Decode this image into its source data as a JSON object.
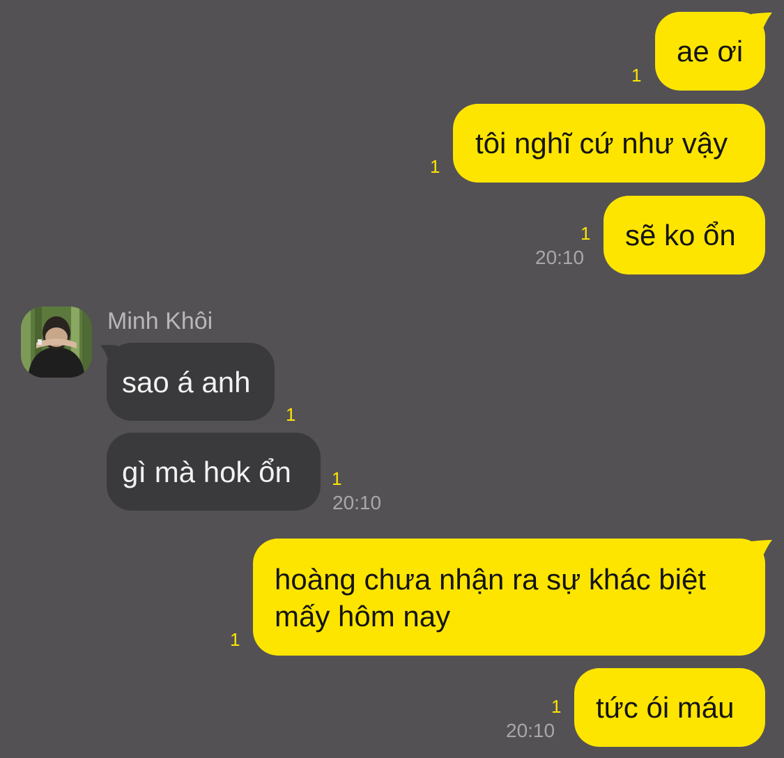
{
  "colors": {
    "background": "#535154",
    "outgoing_bubble": "#fee500",
    "incoming_bubble": "#3a393b",
    "unread_count": "#fee500",
    "timestamp": "#a9a7aa"
  },
  "contact": {
    "name": "Minh Khôi",
    "avatar_icon": "profile-photo"
  },
  "messages": [
    {
      "direction": "outgoing",
      "text": "ae ơi",
      "unread": "1",
      "time": ""
    },
    {
      "direction": "outgoing",
      "text": "tôi nghĩ cứ như vậy",
      "unread": "1",
      "time": ""
    },
    {
      "direction": "outgoing",
      "text": "sẽ ko ổn",
      "unread": "1",
      "time": "20:10"
    },
    {
      "direction": "incoming",
      "text": "sao á anh",
      "unread": "1",
      "time": ""
    },
    {
      "direction": "incoming",
      "text": "gì mà hok ổn",
      "unread": "1",
      "time": "20:10"
    },
    {
      "direction": "outgoing",
      "text": "hoàng chưa nhận ra sự khác biệt mấy hôm nay",
      "unread": "1",
      "time": ""
    },
    {
      "direction": "outgoing",
      "text": "tức ói máu",
      "unread": "1",
      "time": "20:10"
    }
  ]
}
